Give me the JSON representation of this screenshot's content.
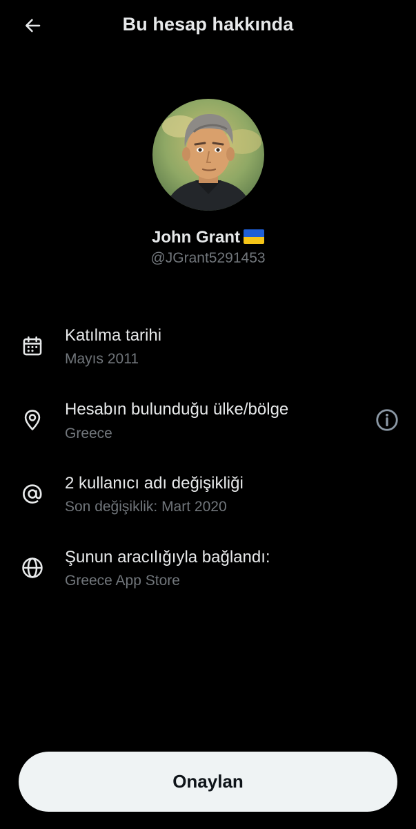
{
  "header": {
    "back_icon": "arrow-left-icon",
    "title": "Bu hesap hakkında"
  },
  "profile": {
    "avatar_icon": "profile-avatar",
    "name": "John Grant",
    "flag_icon": "ukraine-flag-icon",
    "handle": "@JGrant5291453"
  },
  "rows": [
    {
      "icon": "calendar-icon",
      "title": "Katılma tarihi",
      "subtitle": "Mayıs 2011"
    },
    {
      "icon": "location-pin-icon",
      "title": "Hesabın bulunduğu ülke/bölge",
      "subtitle": "Greece",
      "help_icon": "info-circle-icon"
    },
    {
      "icon": "at-sign-icon",
      "title": "2 kullanıcı adı değişikliği",
      "subtitle": "Son değişiklik: Mart 2020"
    },
    {
      "icon": "globe-icon",
      "title": "Şunun aracılığıyla bağlandı:",
      "subtitle": "Greece App Store"
    }
  ],
  "confirm_button": "Onaylan",
  "colors": {
    "background": "#000000",
    "primary_text": "#e7e9ea",
    "secondary_text": "#71767b",
    "button_bg": "#eff3f4",
    "button_text": "#0f1419"
  }
}
